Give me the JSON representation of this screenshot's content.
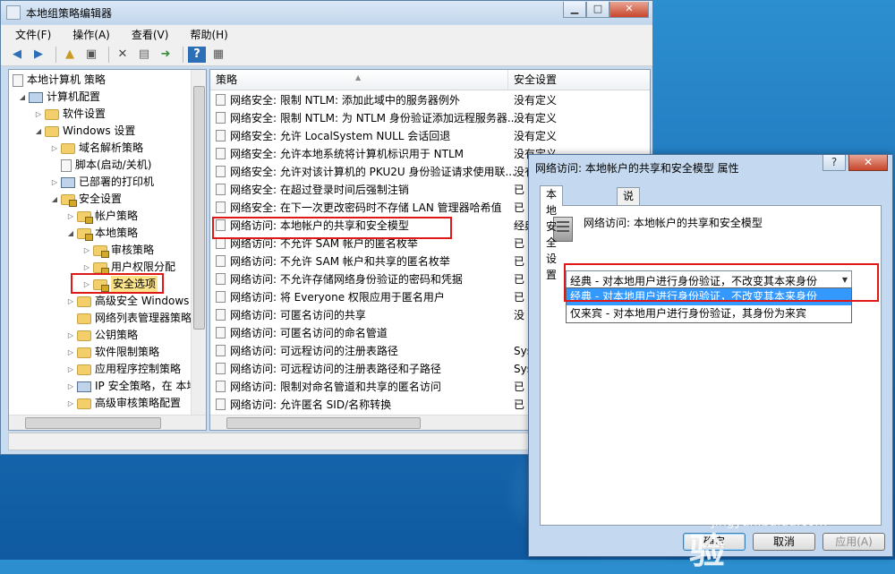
{
  "window": {
    "title": "本地组策略编辑器",
    "menu": [
      "文件(F)",
      "操作(A)",
      "查看(V)",
      "帮助(H)"
    ]
  },
  "tree": {
    "root": "本地计算机 策略",
    "computer_config": "计算机配置",
    "software_settings": "软件设置",
    "windows_settings": "Windows 设置",
    "dns_policy": "域名解析策略",
    "scripts": "脚本(启动/关机)",
    "deployed_printers": "已部署的打印机",
    "security_settings": "安全设置",
    "account_policies": "帐户策略",
    "local_policies": "本地策略",
    "audit_policy": "审核策略",
    "user_rights": "用户权限分配",
    "security_options": "安全选项",
    "advanced_firewall": "高级安全 Windows F",
    "network_list": "网络列表管理器策略",
    "public_key": "公钥策略",
    "software_restriction": "软件限制策略",
    "app_control": "应用程序控制策略",
    "ip_security": "IP 安全策略，在 本地",
    "advanced_audit": "高级审核策略配置"
  },
  "list": {
    "col_policy": "策略",
    "col_setting": "安全设置",
    "rows": [
      {
        "name": "网络安全: 限制 NTLM: 添加此域中的服务器例外",
        "setting": "没有定义"
      },
      {
        "name": "网络安全: 限制 NTLM: 为 NTLM 身份验证添加远程服务器...",
        "setting": "没有定义"
      },
      {
        "name": "网络安全: 允许 LocalSystem NULL 会话回退",
        "setting": "没有定义"
      },
      {
        "name": "网络安全: 允许本地系统将计算机标识用于 NTLM",
        "setting": "没有定义"
      },
      {
        "name": "网络安全: 允许对该计算机的 PKU2U 身份验证请求使用联...",
        "setting": "没有定义"
      },
      {
        "name": "网络安全: 在超过登录时间后强制注销",
        "setting": "已"
      },
      {
        "name": "网络安全: 在下一次更改密码时不存储 LAN 管理器哈希值",
        "setting": "已"
      },
      {
        "name": "网络访问: 本地帐户的共享和安全模型",
        "setting": "经典"
      },
      {
        "name": "网络访问: 不允许 SAM 帐户的匿名枚举",
        "setting": "已"
      },
      {
        "name": "网络访问: 不允许 SAM 帐户和共享的匿名枚举",
        "setting": "已"
      },
      {
        "name": "网络访问: 不允许存储网络身份验证的密码和凭据",
        "setting": "已"
      },
      {
        "name": "网络访问: 将 Everyone 权限应用于匿名用户",
        "setting": "已"
      },
      {
        "name": "网络访问: 可匿名访问的共享",
        "setting": "没"
      },
      {
        "name": "网络访问: 可匿名访问的命名管道",
        "setting": ""
      },
      {
        "name": "网络访问: 可远程访问的注册表路径",
        "setting": "Sys"
      },
      {
        "name": "网络访问: 可远程访问的注册表路径和子路径",
        "setting": "Sys"
      },
      {
        "name": "网络访问: 限制对命名管道和共享的匿名访问",
        "setting": "已"
      },
      {
        "name": "网络访问: 允许匿名 SID/名称转换",
        "setting": "已"
      }
    ]
  },
  "dialog": {
    "title": "网络访问: 本地帐户的共享和安全模型 属性",
    "tab_local": "本地安全设置",
    "tab_explain": "说明",
    "policy_name": "网络访问: 本地帐户的共享和安全模型",
    "selected_value": "经典 - 对本地用户进行身份验证，不改变其本来身份",
    "options": [
      "经典 - 对本地用户进行身份验证，不改变其本来身份",
      "仅来宾 - 对本地用户进行身份验证，其身份为来宾"
    ],
    "ok": "确定",
    "cancel": "取消",
    "apply": "应用(A)",
    "help_glyph": "?",
    "close_glyph": "✕"
  },
  "watermark": {
    "text": "Bai du 经验",
    "sub": "jingyan.baidu.com"
  },
  "colors": {
    "highlight_red": "#e01818",
    "selection_blue": "#3399ff"
  }
}
